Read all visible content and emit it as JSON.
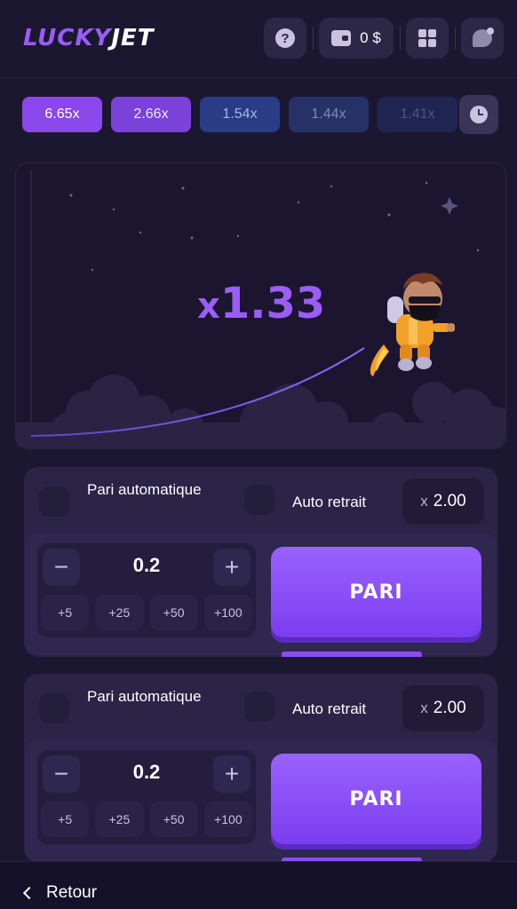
{
  "header": {
    "logo_lucky": "LUCKY",
    "logo_jet": "JET",
    "help_icon_text": "?",
    "balance": "0 $"
  },
  "history": [
    "6.65x",
    "2.66x",
    "1.54x",
    "1.44x",
    "1.41x"
  ],
  "game": {
    "multiplier_prefix": "x",
    "multiplier_value": "1.33"
  },
  "panels": [
    {
      "auto_bet_label": "Pari automatique",
      "auto_cashout_label": "Auto retrait",
      "cashout_prefix": "x",
      "cashout_value": "2.00",
      "minus": "−",
      "plus": "+",
      "stake": "0.2",
      "quick": [
        "+5",
        "+25",
        "+50",
        "+100"
      ],
      "bet_label": "PARI"
    },
    {
      "auto_bet_label": "Pari automatique",
      "auto_cashout_label": "Auto retrait",
      "cashout_prefix": "x",
      "cashout_value": "2.00",
      "minus": "−",
      "plus": "+",
      "stake": "0.2",
      "quick": [
        "+5",
        "+25",
        "+50",
        "+100"
      ],
      "bet_label": "PARI"
    }
  ],
  "footer": {
    "back_label": "Retour"
  },
  "colors": {
    "background": "#1c1731",
    "accent": "#9a5df5",
    "button": "#8a4cf5"
  }
}
